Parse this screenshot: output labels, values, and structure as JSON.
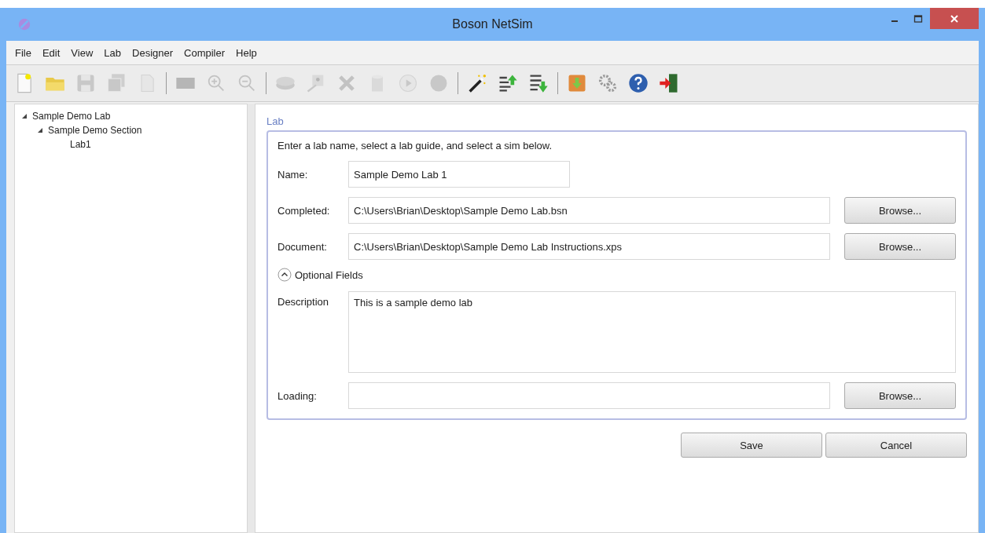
{
  "window": {
    "title": "Boson NetSim"
  },
  "menu": [
    "File",
    "Edit",
    "View",
    "Lab",
    "Designer",
    "Compiler",
    "Help"
  ],
  "toolbar": [
    {
      "kind": "new",
      "disabled": false
    },
    {
      "kind": "open",
      "disabled": false
    },
    {
      "kind": "save",
      "disabled": true
    },
    {
      "kind": "save-all",
      "disabled": true
    },
    {
      "kind": "page",
      "disabled": true
    },
    {
      "kind": "separator"
    },
    {
      "kind": "screen",
      "disabled": true
    },
    {
      "kind": "zoom-in",
      "disabled": true
    },
    {
      "kind": "zoom-out",
      "disabled": true
    },
    {
      "kind": "separator"
    },
    {
      "kind": "router",
      "disabled": true
    },
    {
      "kind": "device",
      "disabled": true
    },
    {
      "kind": "delete",
      "disabled": true
    },
    {
      "kind": "cylinder",
      "disabled": true
    },
    {
      "kind": "play",
      "disabled": true
    },
    {
      "kind": "stop",
      "disabled": true
    },
    {
      "kind": "separator"
    },
    {
      "kind": "wand",
      "disabled": false
    },
    {
      "kind": "export",
      "disabled": false
    },
    {
      "kind": "import",
      "disabled": false
    },
    {
      "kind": "separator"
    },
    {
      "kind": "package",
      "disabled": false
    },
    {
      "kind": "gears",
      "disabled": false
    },
    {
      "kind": "help",
      "disabled": false
    },
    {
      "kind": "exit",
      "disabled": false
    }
  ],
  "tree": [
    {
      "label": "Sample Demo Lab",
      "expanded": true,
      "children": [
        {
          "label": "Sample Demo Section",
          "expanded": true,
          "children": [
            {
              "label": "Lab1"
            }
          ]
        }
      ]
    }
  ],
  "form": {
    "title": "Lab",
    "instructions": "Enter a lab name, select a lab guide, and select a sim below.",
    "name": {
      "label": "Name:",
      "value": "Sample Demo Lab 1"
    },
    "completed": {
      "label": "Completed:",
      "value": "C:\\Users\\Brian\\Desktop\\Sample Demo Lab.bsn",
      "button": "Browse..."
    },
    "document": {
      "label": "Document:",
      "value": "C:\\Users\\Brian\\Desktop\\Sample Demo Lab Instructions.xps",
      "button": "Browse..."
    },
    "optional": {
      "label": "Optional Fields",
      "expanded": true
    },
    "description": {
      "label": "Description",
      "value": "This is a sample demo lab"
    },
    "loading": {
      "label": "Loading:",
      "button": "Browse..."
    }
  },
  "buttons": [
    "Save",
    "Cancel"
  ]
}
